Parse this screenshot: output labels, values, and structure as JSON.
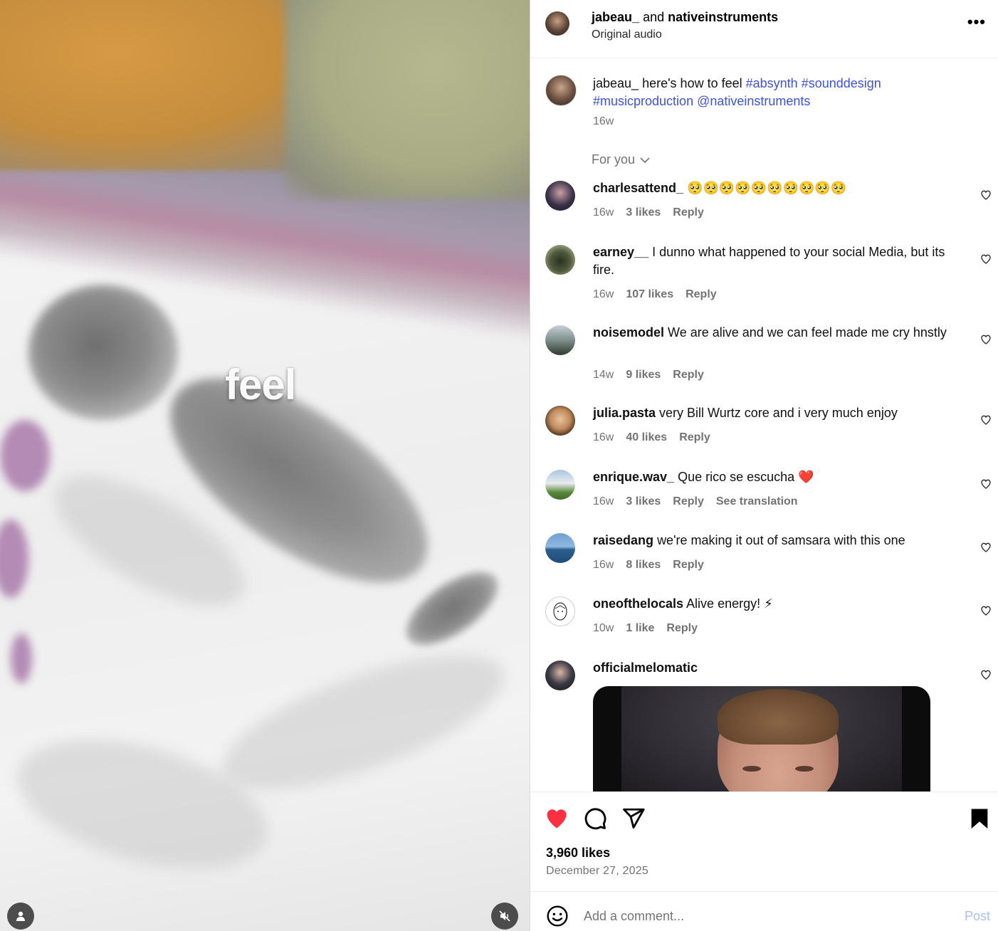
{
  "media": {
    "caption": "feel",
    "profile_icon": "person-icon",
    "mute_icon": "speaker-muted-icon"
  },
  "header": {
    "user1": "jabeau_",
    "joiner": "and",
    "user2": "nativeinstruments",
    "subtitle": "Original audio",
    "more": "•••"
  },
  "post_caption": {
    "user": "jabeau_",
    "text": "here's how to feel",
    "tags": [
      "#absynth",
      "#sounddesign",
      "#musicproduction",
      "@nativeinstruments"
    ],
    "time": "16w"
  },
  "filter": {
    "label": "For you"
  },
  "comments": [
    {
      "user": "charlesattend_",
      "text": "🥺🥺🥺🥺🥺🥺🥺🥺🥺🥺",
      "time": "16w",
      "likes": "3 likes",
      "reply": "Reply",
      "extra": ""
    },
    {
      "user": "earney__",
      "text": "I dunno what happened to your social Media, but its fire.",
      "time": "16w",
      "likes": "107 likes",
      "reply": "Reply",
      "extra": ""
    },
    {
      "user": "noisemodel",
      "text": "We are alive and we can feel made me cry hnstly",
      "time": "14w",
      "likes": "9 likes",
      "reply": "Reply",
      "extra": ""
    },
    {
      "user": "julia.pasta",
      "text": "very Bill Wurtz core and i very much enjoy",
      "time": "16w",
      "likes": "40 likes",
      "reply": "Reply",
      "extra": ""
    },
    {
      "user": "enrique.wav_",
      "text": "Que rico se escucha ❤️",
      "time": "16w",
      "likes": "3 likes",
      "reply": "Reply",
      "extra": "See translation"
    },
    {
      "user": "raisedang",
      "text": "we're making it out of samsara with this one",
      "time": "16w",
      "likes": "8 likes",
      "reply": "Reply",
      "extra": ""
    },
    {
      "user": "oneofthelocals",
      "text": "Alive energy! ⚡",
      "time": "10w",
      "likes": "1 like",
      "reply": "Reply",
      "extra": ""
    },
    {
      "user": "officialmelomatic",
      "text": "",
      "time": "",
      "likes": "",
      "reply": "",
      "extra": ""
    }
  ],
  "actions": {
    "like_icon": "heart-filled-icon",
    "comment_icon": "comment-bubble-icon",
    "share_icon": "paper-plane-icon",
    "save_icon": "bookmark-icon",
    "likes": "3,960 likes",
    "date": "December 27, 2025"
  },
  "add_comment": {
    "placeholder": "Add a comment...",
    "post_label": "Post",
    "emoji_icon": "smiley-icon"
  },
  "colors": {
    "accent_link": "#3e53d6",
    "like_red": "#ff3040",
    "muted_text": "#737373",
    "post_disabled": "#a8c0f5"
  }
}
